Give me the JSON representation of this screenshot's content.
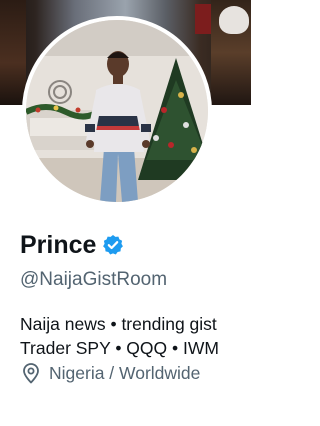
{
  "profile": {
    "display_name": "Prince",
    "handle": "@NaijaGistRoom",
    "bio_lines": [
      "Naija news • trending gist",
      "Trader SPY • QQQ • IWM"
    ],
    "location": "Nigeria / Worldwide",
    "verified": true
  },
  "icons": {
    "verified": "verified-badge-icon",
    "location": "location-pin-icon"
  },
  "colors": {
    "primary_text": "#0f1419",
    "secondary_text": "#536471",
    "verified_blue": "#1d9bf0",
    "background": "#ffffff"
  }
}
